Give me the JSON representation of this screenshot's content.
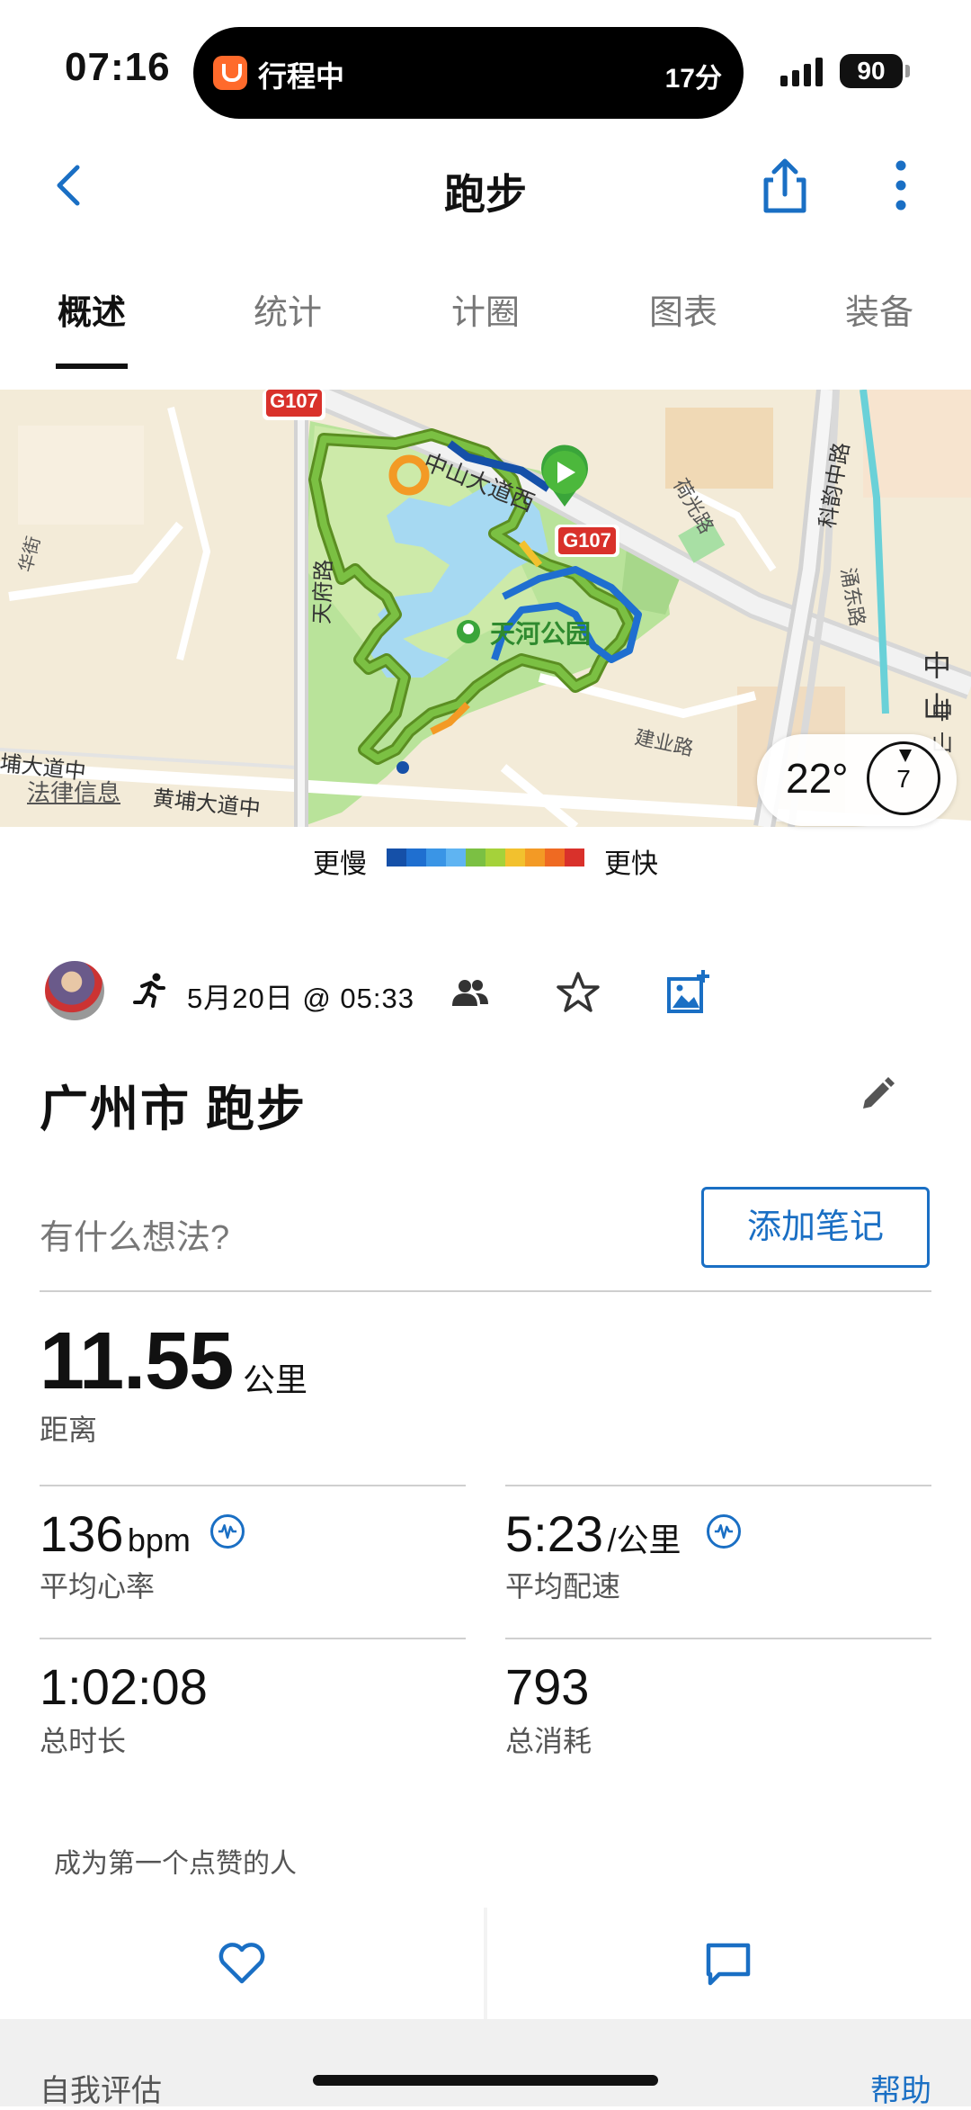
{
  "status": {
    "time": "07:16",
    "island_left": "行程中",
    "island_right": "17分",
    "battery": "90"
  },
  "header": {
    "title": "跑步"
  },
  "tabs": [
    "概述",
    "统计",
    "计圈",
    "图表",
    "装备"
  ],
  "map": {
    "labels": {
      "g107_a": "G107",
      "g107_b": "G107",
      "zhongshan": "中山大道西",
      "park": "天河公园",
      "tianfu": "天府路",
      "heguang": "荷光路",
      "keyun": "科韵中路",
      "yongdong": "涌东路",
      "zhongshan2": "中山",
      "zhongshan3": "中山",
      "jianye": "建业路",
      "huangpu": "黄埔大道中",
      "huangpu2": "埔大道中",
      "legal": "法律信息",
      "huahua": "华街"
    },
    "weather_temp": "22°",
    "wind_speed": "7",
    "legend_slow": "更慢",
    "legend_fast": "更快",
    "legend_colors": [
      "#1550a8",
      "#1f6fd0",
      "#3a95e6",
      "#5fb4f2",
      "#7bc043",
      "#a5d23a",
      "#f2c12e",
      "#f39a25",
      "#ef6a22",
      "#d9312b"
    ]
  },
  "activity": {
    "date": "5月20日 @ 05:33",
    "title": "广州市 跑步",
    "note_placeholder": "有什么想法?",
    "add_note": "添加笔记"
  },
  "stats": {
    "distance_value": "11.55",
    "distance_unit": "公里",
    "distance_label": "距离",
    "hr_value": "136",
    "hr_unit": "bpm",
    "hr_label": "平均心率",
    "pace_value": "5:23",
    "pace_unit": "/公里",
    "pace_label": "平均配速",
    "duration_value": "1:02:08",
    "duration_label": "总时长",
    "calories_value": "793",
    "calories_label": "总消耗"
  },
  "social": {
    "like_prompt": "成为第一个点赞的人"
  },
  "footer": {
    "self_eval": "自我评估",
    "help": "帮助"
  },
  "colors": {
    "accent": "#1a6fc4",
    "route_green": "#6aaa2b"
  }
}
